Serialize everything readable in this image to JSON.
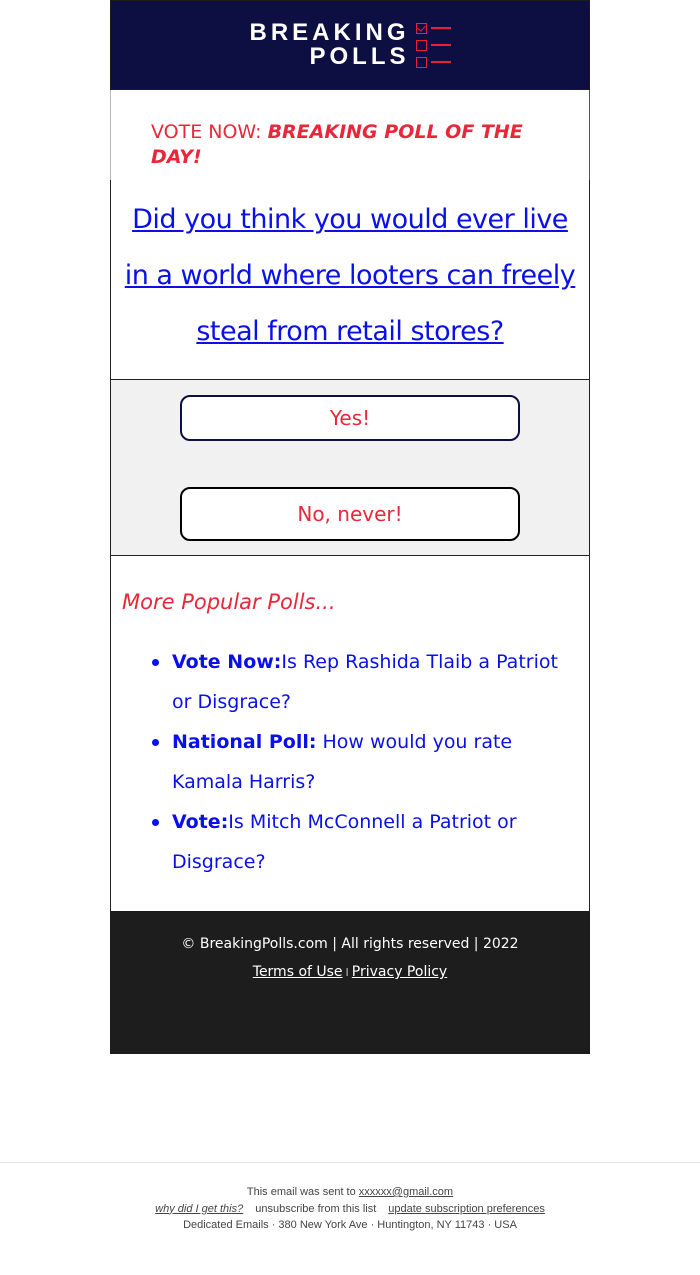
{
  "header": {
    "logo_line1": "BREAKING",
    "logo_line2": "POLLS",
    "logo_icon": "checklist-icon",
    "bg_color": "#0d0f42",
    "accent_color": "#e8203a"
  },
  "vote_now": {
    "label": "VOTE NOW: ",
    "highlight": "BREAKING POLL OF THE DAY!"
  },
  "question": {
    "text": "Did you think you would ever live in a world where looters can freely steal from retail stores?"
  },
  "answers": [
    {
      "label": "Yes!"
    },
    {
      "label": "No, never!"
    }
  ],
  "more_polls": {
    "title": "More Popular Polls...",
    "items": [
      {
        "prefix": "Vote Now:",
        "text": "Is Rep Rashida Tlaib a Patriot or Disgrace?"
      },
      {
        "prefix": "National Poll:",
        "text": " How would you rate Kamala Harris?"
      },
      {
        "prefix": "Vote:",
        "text": "Is Mitch McConnell a Patriot or Disgrace?"
      }
    ]
  },
  "footer": {
    "copyright": "© BreakingPolls.com | All rights reserved | 2022",
    "terms": "Terms of Use",
    "separator": "I",
    "privacy": "Privacy Policy"
  },
  "email_footer": {
    "sent_to_label": "This email was sent to ",
    "email": "xxxxxx@gmail.com",
    "why": "why did I get this?",
    "unsubscribe": "unsubscribe from this list",
    "update_prefs": "update subscription preferences",
    "address": "Dedicated Emails · 380 New York Ave · Huntington, NY 11743 · USA"
  }
}
